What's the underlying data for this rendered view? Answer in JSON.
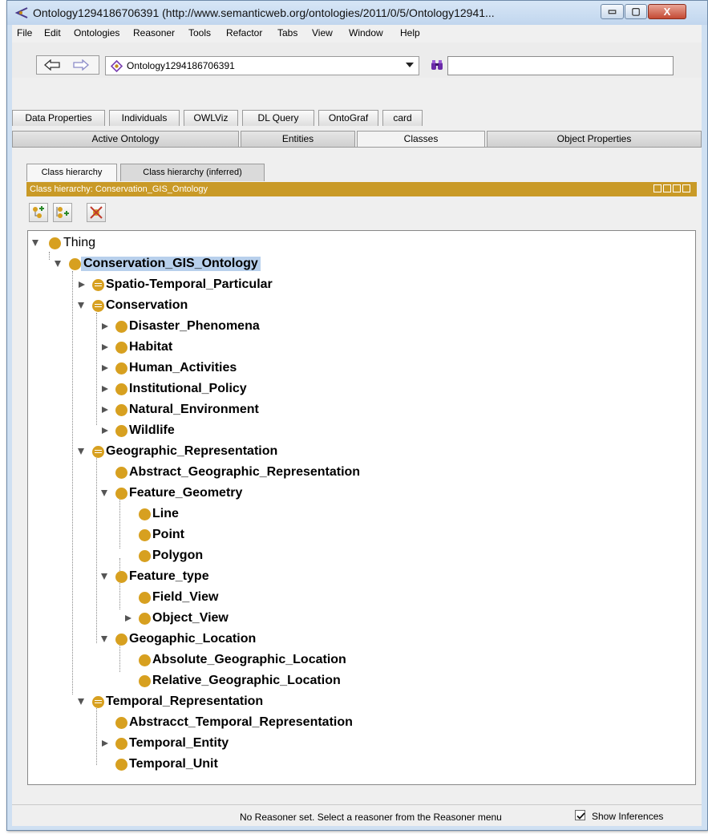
{
  "window": {
    "title": "Ontology1294186706391 (http://www.semanticweb.org/ontologies/2011/0/5/Ontology12941...",
    "min_symbol": "▭",
    "max_symbol": "▢",
    "close_symbol": "X"
  },
  "menu": [
    "File",
    "Edit",
    "Ontologies",
    "Reasoner",
    "Tools",
    "Refactor",
    "Tabs",
    "View",
    "Window",
    "Help"
  ],
  "toolbar": {
    "ontology_combo": "Ontology1294186706391",
    "search_value": ""
  },
  "tabs_row1": [
    "Data Properties",
    "Individuals",
    "OWLViz",
    "DL Query",
    "OntoGraf",
    "card"
  ],
  "tabs_row2": [
    "Active Ontology",
    "Entities",
    "Classes",
    "Object Properties"
  ],
  "tabs_row2_selected": "Classes",
  "view": {
    "subtabs": [
      "Class hierarchy",
      "Class hierarchy (inferred)"
    ],
    "header_title": "Class hierarchy: Conservation_GIS_Ontology"
  },
  "tree": {
    "thing": "Thing",
    "root": "Conservation_GIS_Ontology",
    "spatio": "Spatio-Temporal_Particular",
    "conservation": "Conservation",
    "disaster": "Disaster_Phenomena",
    "habitat": "Habitat",
    "human": "Human_Activities",
    "institutional": "Institutional_Policy",
    "natural": "Natural_Environment",
    "wildlife": "Wildlife",
    "geo_rep": "Geographic_Representation",
    "abstract_geo": "Abstract_Geographic_Representation",
    "feature_geometry": "Feature_Geometry",
    "line": "Line",
    "point": "Point",
    "polygon": "Polygon",
    "feature_type": "Feature_type",
    "field_view": "Field_View",
    "object_view": "Object_View",
    "geo_location": "Geogaphic_Location",
    "absolute_loc": "Absolute_Geographic_Location",
    "relative_loc": "Relative_Geographic_Location",
    "temporal_rep": "Temporal_Representation",
    "abstract_temp": "Abstracct_Temporal_Representation",
    "temporal_entity": "Temporal_Entity",
    "temporal_unit": "Temporal_Unit"
  },
  "status": {
    "message": "No Reasoner set. Select a reasoner from the Reasoner menu",
    "show_inferences_label": "Show Inferences",
    "show_inferences_checked": true
  },
  "colors": {
    "class_icon": "#d7a020",
    "view_header": "#c99a27",
    "selection": "#b8d0ec"
  }
}
